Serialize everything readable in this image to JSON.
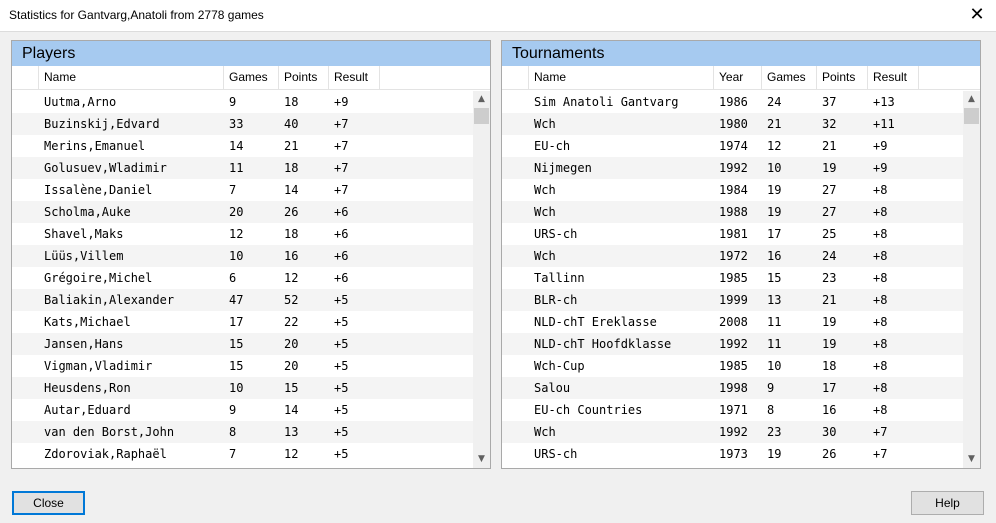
{
  "window": {
    "title": "Statistics for Gantvarg,Anatoli from 2778 games",
    "close_symbol": "✕"
  },
  "players": {
    "header": "Players",
    "columns": [
      "Name",
      "Games",
      "Points",
      "Result"
    ],
    "rows": [
      [
        "Uutma,Arno",
        "9",
        "18",
        "+9"
      ],
      [
        "Buzinskij,Edvard",
        "33",
        "40",
        "+7"
      ],
      [
        "Merins,Emanuel",
        "14",
        "21",
        "+7"
      ],
      [
        "Golusuev,Wladimir",
        "11",
        "18",
        "+7"
      ],
      [
        "Issalène,Daniel",
        "7",
        "14",
        "+7"
      ],
      [
        "Scholma,Auke",
        "20",
        "26",
        "+6"
      ],
      [
        "Shavel,Maks",
        "12",
        "18",
        "+6"
      ],
      [
        "Lüüs,Villem",
        "10",
        "16",
        "+6"
      ],
      [
        "Grégoire,Michel",
        "6",
        "12",
        "+6"
      ],
      [
        "Baliakin,Alexander",
        "47",
        "52",
        "+5"
      ],
      [
        "Kats,Michael",
        "17",
        "22",
        "+5"
      ],
      [
        "Jansen,Hans",
        "15",
        "20",
        "+5"
      ],
      [
        "Vigman,Vladimir",
        "15",
        "20",
        "+5"
      ],
      [
        "Heusdens,Ron",
        "10",
        "15",
        "+5"
      ],
      [
        "Autar,Eduard",
        "9",
        "14",
        "+5"
      ],
      [
        "van den Borst,John",
        "8",
        "13",
        "+5"
      ],
      [
        "Zdoroviak,Raphaël",
        "7",
        "12",
        "+5"
      ]
    ]
  },
  "tournaments": {
    "header": "Tournaments",
    "columns": [
      "Name",
      "Year",
      "Games",
      "Points",
      "Result"
    ],
    "rows": [
      [
        "Sim Anatoli Gantvarg",
        "1986",
        "24",
        "37",
        "+13"
      ],
      [
        "Wch",
        "1980",
        "21",
        "32",
        "+11"
      ],
      [
        "EU-ch",
        "1974",
        "12",
        "21",
        "+9"
      ],
      [
        "Nijmegen",
        "1992",
        "10",
        "19",
        "+9"
      ],
      [
        "Wch",
        "1984",
        "19",
        "27",
        "+8"
      ],
      [
        "Wch",
        "1988",
        "19",
        "27",
        "+8"
      ],
      [
        "URS-ch",
        "1981",
        "17",
        "25",
        "+8"
      ],
      [
        "Wch",
        "1972",
        "16",
        "24",
        "+8"
      ],
      [
        "Tallinn",
        "1985",
        "15",
        "23",
        "+8"
      ],
      [
        "BLR-ch",
        "1999",
        "13",
        "21",
        "+8"
      ],
      [
        "NLD-chT Ereklasse",
        "2008",
        "11",
        "19",
        "+8"
      ],
      [
        "NLD-chT Hoofdklasse",
        "1992",
        "11",
        "19",
        "+8"
      ],
      [
        "Wch-Cup",
        "1985",
        "10",
        "18",
        "+8"
      ],
      [
        "Salou",
        "1998",
        "9",
        "17",
        "+8"
      ],
      [
        "EU-ch Countries",
        "1971",
        "8",
        "16",
        "+8"
      ],
      [
        "Wch",
        "1992",
        "23",
        "30",
        "+7"
      ],
      [
        "URS-ch",
        "1973",
        "19",
        "26",
        "+7"
      ]
    ]
  },
  "scroll": {
    "up_symbol": "▲",
    "down_symbol": "▼"
  },
  "buttons": {
    "close_label": "Close",
    "help_label": "Help"
  },
  "colors": {
    "panel_header": "#a6caf0",
    "focus_border": "#0078d7",
    "alt_row": "#f4f4f4"
  }
}
